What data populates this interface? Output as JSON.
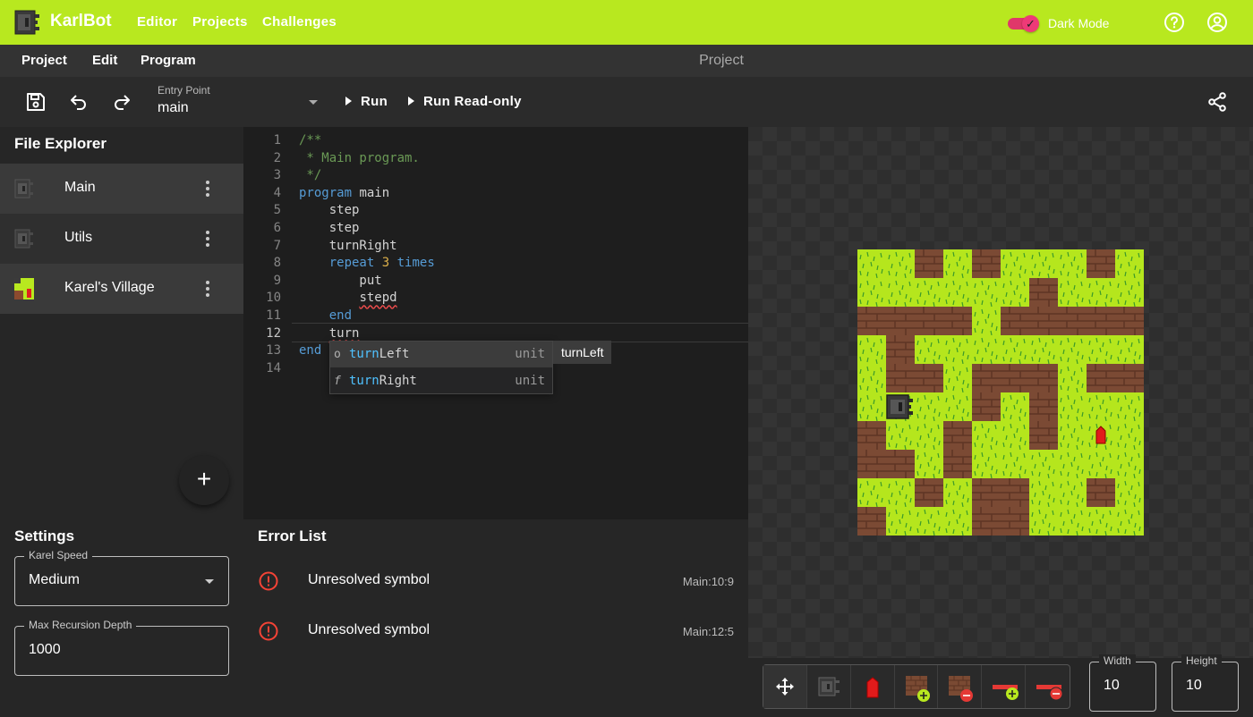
{
  "app": {
    "brand": "KarlBot",
    "nav": [
      "Editor",
      "Projects",
      "Challenges"
    ],
    "dark_mode_label": "Dark Mode",
    "dark_mode_on": true
  },
  "menu": {
    "items": [
      "Project",
      "Edit",
      "Program"
    ],
    "title": "Project"
  },
  "toolbar": {
    "entry_point_label": "Entry Point",
    "entry_point_value": "main",
    "run_label": "Run",
    "run_readonly_label": "Run Read-only"
  },
  "explorer": {
    "title": "File Explorer",
    "files": [
      {
        "name": "Main",
        "icon": "robot-icon"
      },
      {
        "name": "Utils",
        "icon": "robot-icon"
      },
      {
        "name": "Karel's Village",
        "icon": "world-icon"
      }
    ],
    "add_symbol": "+"
  },
  "editor": {
    "current_line": 12,
    "line_numbers": [
      "1",
      "2",
      "3",
      "4",
      "5",
      "6",
      "7",
      "8",
      "9",
      "10",
      "11",
      "12",
      "13",
      "14"
    ],
    "lines": [
      [
        {
          "t": "/**",
          "c": "c-com"
        }
      ],
      [
        {
          "t": " * Main program.",
          "c": "c-com"
        }
      ],
      [
        {
          "t": " */",
          "c": "c-com"
        }
      ],
      [
        {
          "t": "program",
          "c": "c-kw"
        },
        {
          "t": " main",
          "c": ""
        }
      ],
      [
        {
          "t": "    step",
          "c": ""
        }
      ],
      [
        {
          "t": "    step",
          "c": ""
        }
      ],
      [
        {
          "t": "    turnRight",
          "c": ""
        }
      ],
      [
        {
          "t": "    ",
          "c": ""
        },
        {
          "t": "repeat",
          "c": "c-kw"
        },
        {
          "t": " ",
          "c": ""
        },
        {
          "t": "3",
          "c": "c-num"
        },
        {
          "t": " ",
          "c": ""
        },
        {
          "t": "times",
          "c": "c-kw"
        }
      ],
      [
        {
          "t": "        put",
          "c": ""
        }
      ],
      [
        {
          "t": "        ",
          "c": ""
        },
        {
          "t": "stepd",
          "c": "c-err"
        }
      ],
      [
        {
          "t": "    ",
          "c": ""
        },
        {
          "t": "end",
          "c": "c-kw"
        }
      ],
      [
        {
          "t": "    ",
          "c": ""
        },
        {
          "t": "turn",
          "c": "c-err"
        }
      ],
      [
        {
          "t": "end",
          "c": "c-kw"
        }
      ],
      []
    ],
    "suggestions": [
      {
        "kind": "o",
        "match": "turn",
        "rest": "Left",
        "type": "unit"
      },
      {
        "kind": "f",
        "match": "turn",
        "rest": "Right",
        "type": "unit"
      }
    ],
    "suggestion_detail": "turnLeft"
  },
  "settings": {
    "title": "Settings",
    "karel_speed_label": "Karel Speed",
    "karel_speed_value": "Medium",
    "max_recursion_label": "Max Recursion Depth",
    "max_recursion_value": "1000"
  },
  "errors": {
    "title": "Error List",
    "items": [
      {
        "message": "Unresolved symbol",
        "location": "Main:10:9"
      },
      {
        "message": "Unresolved symbol",
        "location": "Main:12:5"
      }
    ]
  },
  "world": {
    "width_label": "Width",
    "width_value": "10",
    "height_label": "Height",
    "height_value": "10",
    "grid": [
      "..W.W...W.",
      "......W...",
      "WWWW.WWWWW",
      ".W........",
      ".WW.WWW.WW",
      "....W.W...",
      "W..W..W...",
      "WW.W......",
      "..W.WW..W.",
      "W...WW...."
    ],
    "robot": {
      "col": 1,
      "row": 5,
      "facing": "east"
    },
    "beepers": [
      {
        "col": 8,
        "row": 6
      }
    ],
    "tools": [
      "move-icon",
      "robot-tool-icon",
      "beeper-tool-icon",
      "add-wall-icon",
      "remove-wall-icon",
      "add-horizontal-wall-icon",
      "remove-horizontal-wall-icon"
    ]
  }
}
